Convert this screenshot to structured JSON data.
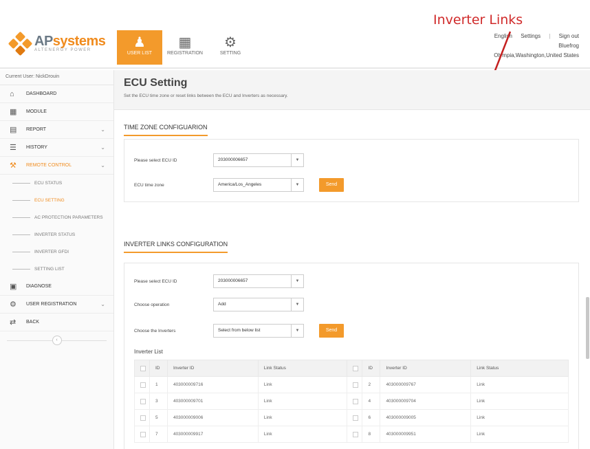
{
  "annotation": {
    "text": "Inverter Links",
    "color": "#d02a2a"
  },
  "brand": {
    "name_a": "AP",
    "name_b": "systems",
    "tagline": "ALTENERGY POWER",
    "accent": "#f39a2b"
  },
  "nav": {
    "tabs": [
      {
        "label": "USER LIST",
        "icon": "users-icon"
      },
      {
        "label": "REGISTRATION",
        "icon": "building-icon"
      },
      {
        "label": "SETTING",
        "icon": "gear-icon"
      }
    ]
  },
  "topright": {
    "links": [
      "English",
      "Settings",
      "|",
      "Sign out"
    ],
    "user": "Bluefrog",
    "location": "Olympia,Washington,United States"
  },
  "sidebar": {
    "current_user": "Current User: NickDrouin",
    "items": [
      {
        "label": "DASHBOARD",
        "icon": "home-icon",
        "chevron": false
      },
      {
        "label": "MODULE",
        "icon": "grid-icon",
        "chevron": false
      },
      {
        "label": "REPORT",
        "icon": "report-icon",
        "chevron": true
      },
      {
        "label": "HISTORY",
        "icon": "database-icon",
        "chevron": true
      },
      {
        "label": "REMOTE CONTROL",
        "icon": "wrench-icon",
        "chevron": true
      }
    ],
    "sub_items": [
      "ECU STATUS",
      "ECU SETTING",
      "AC PROTECTION PARAMETERS",
      "INVERTER STATUS",
      "INVERTER GFDI",
      "SETTING LIST"
    ],
    "items2": [
      {
        "label": "DIAGNOSE",
        "icon": "briefcase-icon",
        "chevron": false
      },
      {
        "label": "USER REGISTRATION",
        "icon": "gears-icon",
        "chevron": true
      },
      {
        "label": "BACK",
        "icon": "back-icon",
        "chevron": false
      }
    ],
    "collapse": "‹"
  },
  "main": {
    "title": "ECU Setting",
    "description": "Set the ECU time zone or reset links between the ECU and Inverters as necessary.",
    "timezone": {
      "section_title": "TIME ZONE CONFIGUARION",
      "ecu_label": "Please select ECU ID",
      "ecu_value": "203000006657",
      "tz_label": "ECU time zone",
      "tz_value": "America/Los_Angeles",
      "send": "Send"
    },
    "links": {
      "section_title": "INVERTER LINKS CONFIGURATION",
      "ecu_label": "Please select ECU ID",
      "ecu_value": "203000006657",
      "op_label": "Choose operation",
      "op_value": "Add",
      "inv_label": "Choose the Inverters",
      "inv_value": "Select from below list",
      "send": "Send",
      "list_title": "Inverter List",
      "headers": [
        "ID",
        "Inverter ID",
        "Link Status",
        "ID",
        "Inverter ID",
        "Link Status"
      ],
      "rows": [
        [
          "1",
          "403000009716",
          "Link",
          "2",
          "403000009767",
          "Link"
        ],
        [
          "3",
          "403000009701",
          "Link",
          "4",
          "403000009704",
          "Link"
        ],
        [
          "5",
          "403000009006",
          "Link",
          "6",
          "403000009005",
          "Link"
        ],
        [
          "7",
          "403000009917",
          "Link",
          "8",
          "403000009951",
          "Link"
        ]
      ]
    }
  }
}
